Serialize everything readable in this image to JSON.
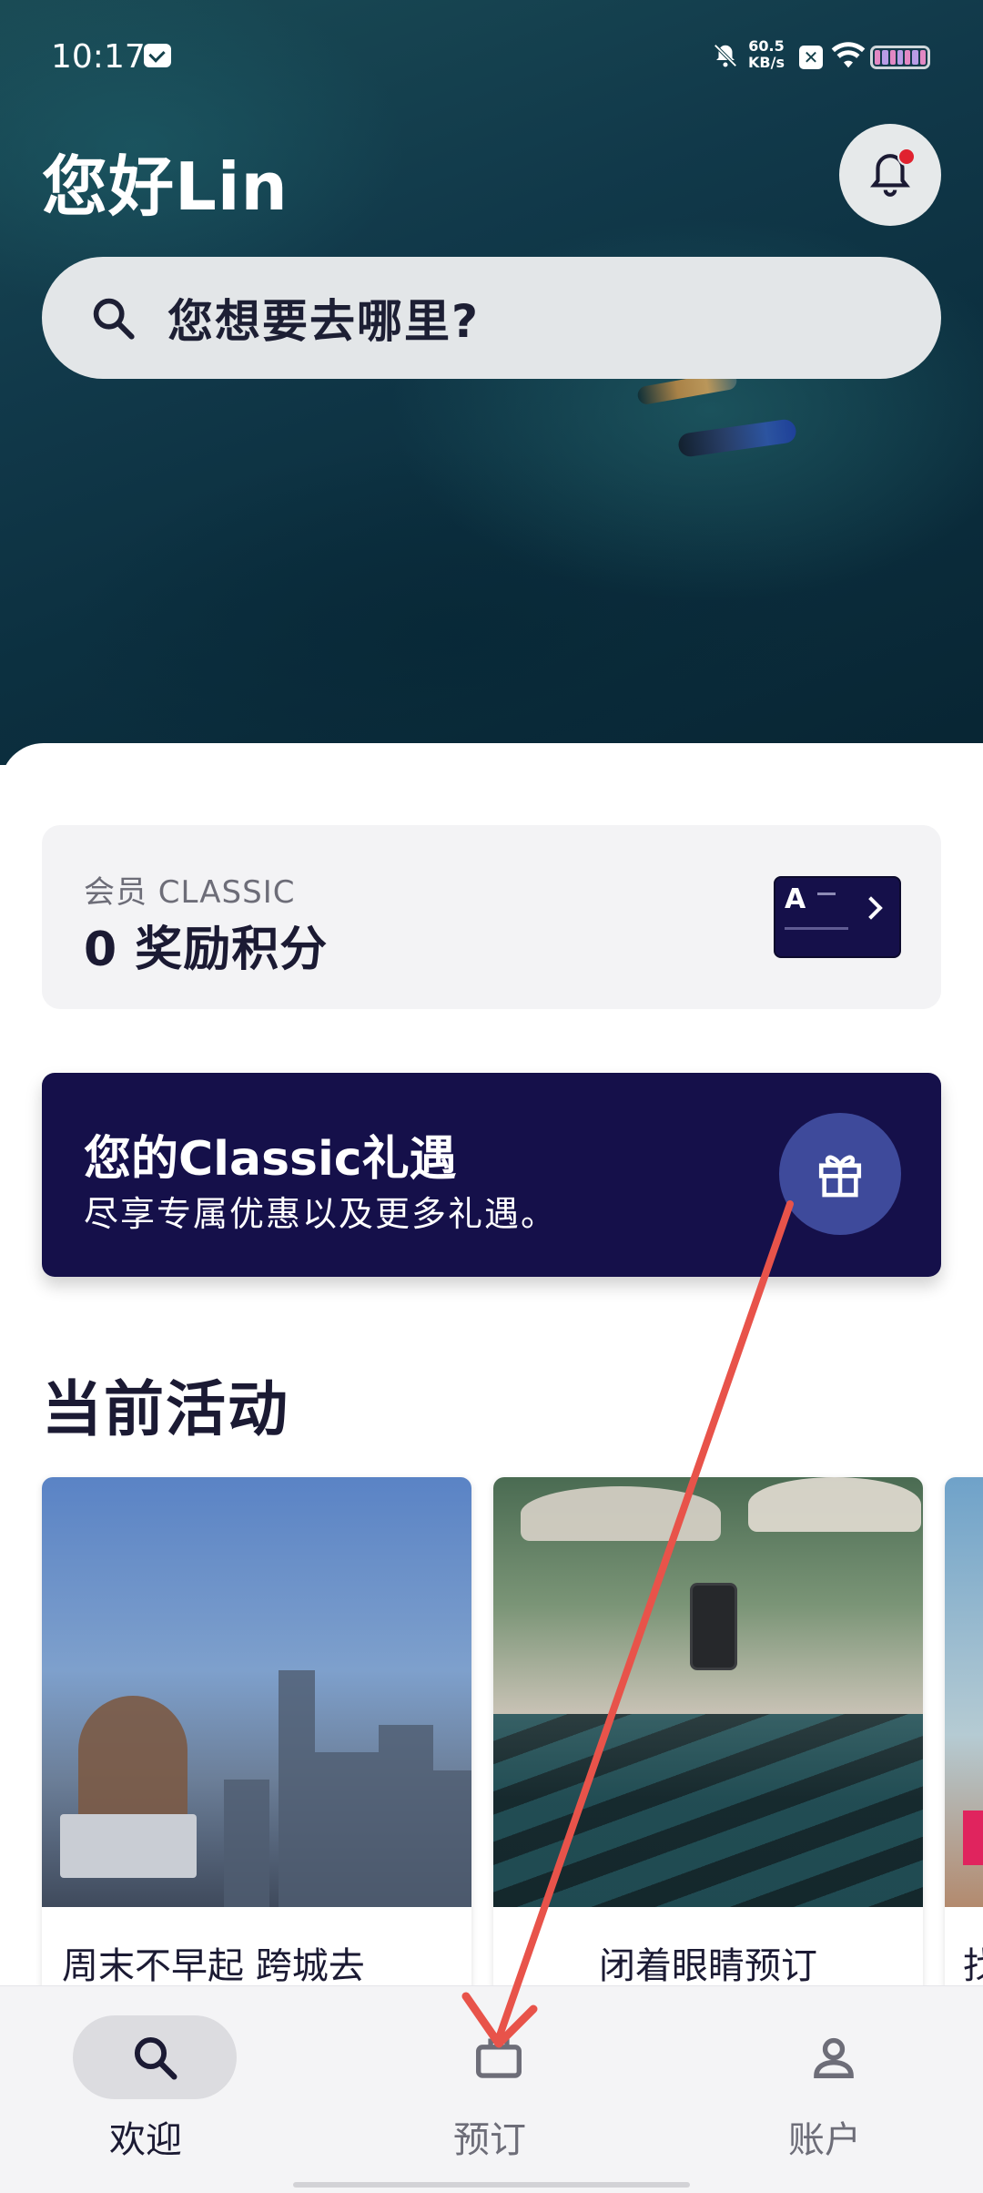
{
  "status_bar": {
    "time": "10:17",
    "net_speed_value": "60.5",
    "net_speed_unit": "KB/s"
  },
  "header": {
    "greeting": "您好Lin",
    "search_placeholder": "您想要去哪里?"
  },
  "membership": {
    "tier": "会员 CLASSIC",
    "points": "0 奖励积分",
    "card_logo": "A"
  },
  "benefit_banner": {
    "title": "您的Classic礼遇",
    "subtitle": "尽享专属优惠以及更多礼遇。"
  },
  "activities": {
    "section_title": "当前活动",
    "cards": [
      {
        "label": "周末不早起 跨城去"
      },
      {
        "label": "闭着眼睛预订"
      },
      {
        "label": "找"
      }
    ]
  },
  "bottom_nav": {
    "items": [
      {
        "label": "欢迎",
        "icon": "search-icon",
        "active": true
      },
      {
        "label": "预订",
        "icon": "briefcase-icon",
        "active": false
      },
      {
        "label": "账户",
        "icon": "person-icon",
        "active": false
      }
    ]
  },
  "colors": {
    "brand_navy": "#15104a",
    "gift_circle": "#3e4a9b",
    "notification_dot": "#e0222f",
    "annotation_arrow": "#e8534a"
  }
}
